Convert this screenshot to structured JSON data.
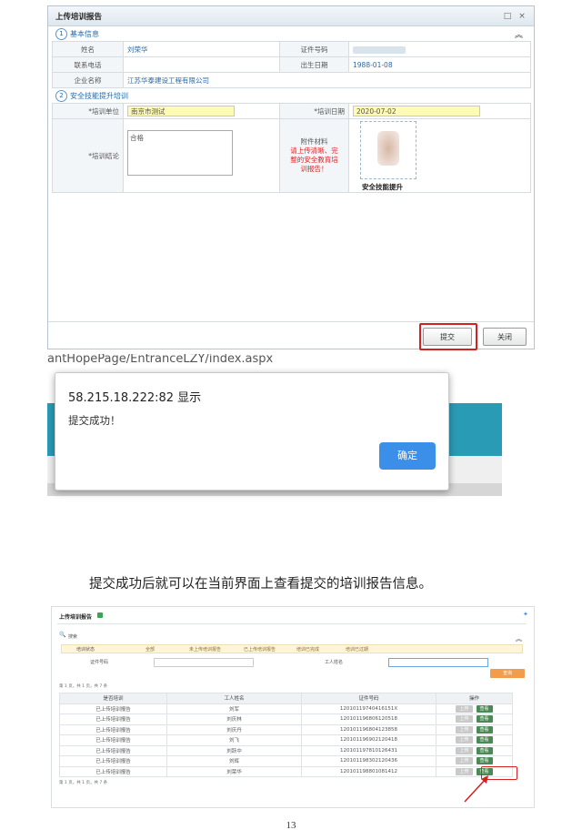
{
  "form_window": {
    "title": "上传培训报告",
    "section1": {
      "num": "1",
      "title": "基本信息"
    },
    "section2": {
      "num": "2",
      "title": "安全技能提升培训"
    },
    "rows": [
      {
        "l1": "姓名",
        "v1": "刘荣华",
        "l2": "证件号码",
        "v2": ""
      },
      {
        "l1": "联系电话",
        "v1": "",
        "l2": "出生日期",
        "v2": "1988-01-08"
      },
      {
        "l1": "企业名称",
        "v1": "江苏华泰建设工程有限公司",
        "l2": "",
        "v2": ""
      }
    ],
    "train_unit_label": "*培训单位",
    "train_unit_value": "南京市测试",
    "train_date_label": "*培训日期",
    "train_date_value": "2020-07-02",
    "conclusion_label": "*培训结论",
    "conclusion_value": "合格",
    "attach_label": "附件材料",
    "attach_note": "请上传清晰、完整的安全教育培训报告！",
    "attach_caption": "安全技能提升",
    "submit_label": "提交",
    "close_label": "关闭"
  },
  "url_bar": {
    "text": "antHopePage/EntranceLZY/index.aspx"
  },
  "alert": {
    "title": "58.215.18.222:82 显示",
    "message": "提交成功！",
    "ok_label": "确定"
  },
  "paragraph": "提交成功后就可以在当前界面上查看提交的培训报告信息。",
  "list_window": {
    "title": "上传培训报告",
    "search_label": "搜索",
    "status_label": "培训状态",
    "status_options": [
      "全部",
      "未上传培训报告",
      "已上传培训报告",
      "培训已完成",
      "培训已过期"
    ],
    "id_label": "证件号码",
    "name_label": "工人姓名",
    "query_label": "查询",
    "pager_top": "第 1 页，共 1 页，共 7 条",
    "pager_bottom": "第 1 页，共 1 页，共 7 条",
    "columns": [
      "是否培训",
      "工人姓名",
      "证件号码",
      "操作"
    ],
    "rows": [
      {
        "status": "已上传培训报告",
        "name": "刘军",
        "id": "12010119740416151X"
      },
      {
        "status": "已上传培训报告",
        "name": "刘庆林",
        "id": "120101196806120518"
      },
      {
        "status": "已上传培训报告",
        "name": "刘庆丹",
        "id": "120101196804123858"
      },
      {
        "status": "已上传培训报告",
        "name": "刘飞",
        "id": "120101196902120418"
      },
      {
        "status": "已上传培训报告",
        "name": "刘跃中",
        "id": "120101197810126431"
      },
      {
        "status": "已上传培训报告",
        "name": "刘辉",
        "id": "120101198302120436"
      },
      {
        "status": "已上传培训报告",
        "name": "刘荣华",
        "id": "120101198801081412"
      }
    ],
    "upload_label": "上传",
    "view_label": "查看"
  },
  "page_number": "13",
  "colors": {
    "accent_blue": "#3c8fe8",
    "highlight_red": "#d32020",
    "view_green": "#4a8a55",
    "input_yellow": "#fffbb4"
  }
}
